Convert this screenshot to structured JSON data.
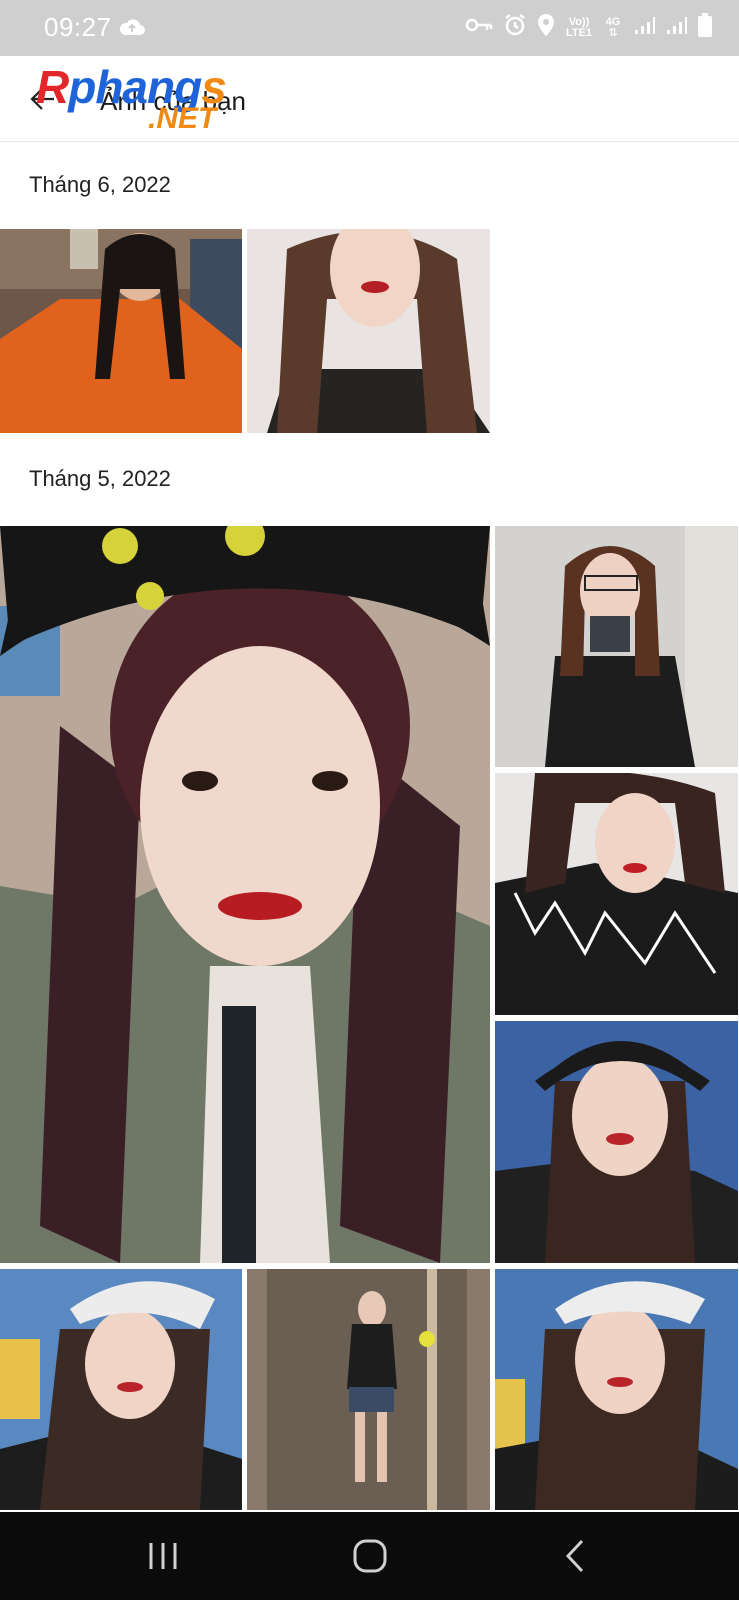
{
  "status_bar": {
    "time": "09:27",
    "volte_label": "Vo)) LTE1",
    "network_label": "4G",
    "icons": [
      "cloud-upload-icon",
      "vpn-key-icon",
      "alarm-icon",
      "location-icon",
      "volte-icon",
      "network-4g-icon",
      "signal-icon",
      "signal-icon-2",
      "battery-icon"
    ]
  },
  "header": {
    "title": "Ảnh của bạn",
    "back_icon": "arrow-back-icon",
    "watermark_line1": "Rphangs",
    "watermark_line2": ".NET"
  },
  "sections": [
    {
      "label": "Tháng 6, 2022",
      "photo_count": 2
    },
    {
      "label": "Tháng 5, 2022",
      "photo_count": 7
    }
  ],
  "nav_bar": {
    "icons": [
      "recent-apps-icon",
      "home-icon",
      "back-icon"
    ]
  },
  "colors": {
    "status_bar": "#cfcfcf",
    "nav_bar": "#0b0b0b",
    "text": "#222222"
  }
}
